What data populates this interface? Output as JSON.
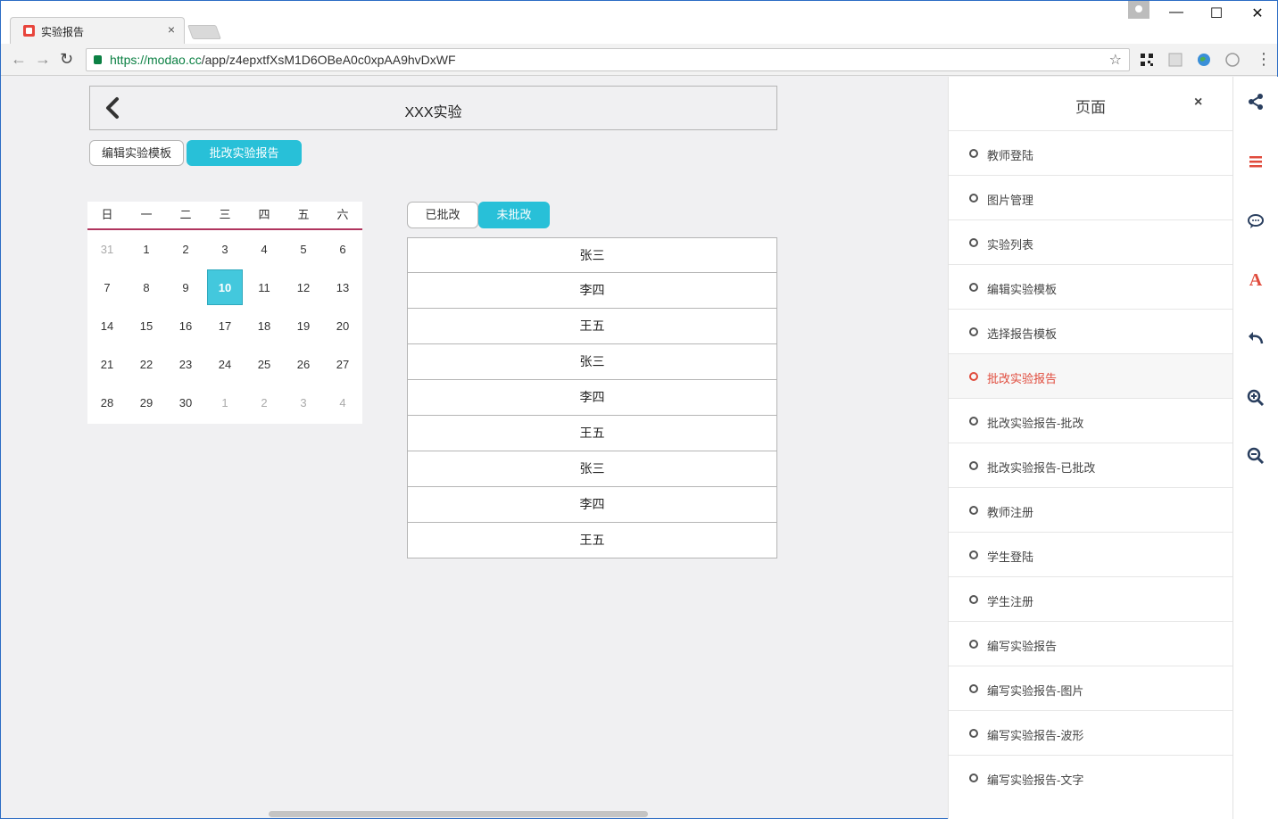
{
  "browser": {
    "tab_title": "实验报告",
    "tab_close": "×",
    "url_host": "https://modao.cc",
    "url_path": "/app/z4epxtfXsM1D6OBeA0c0xpAA9hvDxWF",
    "window_controls": {
      "minimize": "—",
      "maximize": "☐",
      "close": "✕"
    }
  },
  "header": {
    "title": "XXX实验"
  },
  "top_tabs": [
    {
      "label": "编辑实验模板",
      "active": false
    },
    {
      "label": "批改实验报告",
      "active": true
    }
  ],
  "calendar": {
    "weekdays": [
      "日",
      "一",
      "二",
      "三",
      "四",
      "五",
      "六"
    ],
    "weeks": [
      [
        {
          "d": "31",
          "m": true
        },
        {
          "d": "1"
        },
        {
          "d": "2"
        },
        {
          "d": "3"
        },
        {
          "d": "4"
        },
        {
          "d": "5"
        },
        {
          "d": "6"
        }
      ],
      [
        {
          "d": "7"
        },
        {
          "d": "8"
        },
        {
          "d": "9"
        },
        {
          "d": "10",
          "today": true
        },
        {
          "d": "11"
        },
        {
          "d": "12"
        },
        {
          "d": "13"
        }
      ],
      [
        {
          "d": "14"
        },
        {
          "d": "15"
        },
        {
          "d": "16"
        },
        {
          "d": "17"
        },
        {
          "d": "18"
        },
        {
          "d": "19"
        },
        {
          "d": "20"
        }
      ],
      [
        {
          "d": "21"
        },
        {
          "d": "22"
        },
        {
          "d": "23"
        },
        {
          "d": "24"
        },
        {
          "d": "25"
        },
        {
          "d": "26"
        },
        {
          "d": "27"
        }
      ],
      [
        {
          "d": "28"
        },
        {
          "d": "29"
        },
        {
          "d": "30"
        },
        {
          "d": "1",
          "m": true
        },
        {
          "d": "2",
          "m": true
        },
        {
          "d": "3",
          "m": true
        },
        {
          "d": "4",
          "m": true
        }
      ]
    ],
    "accent_color": "#43c8dd"
  },
  "status_tabs": [
    {
      "label": "已批改",
      "active": false
    },
    {
      "label": "未批改",
      "active": true
    }
  ],
  "students": [
    "张三",
    "李四",
    "王五",
    "张三",
    "李四",
    "王五",
    "张三",
    "李四",
    "王五"
  ],
  "panel": {
    "title": "页面",
    "close": "×",
    "active_color": "#e04b3c",
    "items": [
      {
        "label": "教师登陆"
      },
      {
        "label": "图片管理"
      },
      {
        "label": "实验列表"
      },
      {
        "label": "编辑实验模板"
      },
      {
        "label": "选择报告模板"
      },
      {
        "label": "批改实验报告",
        "active": true
      },
      {
        "label": "批改实验报告-批改"
      },
      {
        "label": "批改实验报告-已批改"
      },
      {
        "label": "教师注册"
      },
      {
        "label": "学生登陆"
      },
      {
        "label": "学生注册"
      },
      {
        "label": "编写实验报告"
      },
      {
        "label": "编写实验报告-图片"
      },
      {
        "label": "编写实验报告-波形"
      },
      {
        "label": "编写实验报告-文字"
      }
    ]
  },
  "rail_icons": [
    "share-icon",
    "menu-icon",
    "comment-icon",
    "font-icon",
    "undo-icon",
    "zoom-in-icon",
    "zoom-out-icon"
  ]
}
